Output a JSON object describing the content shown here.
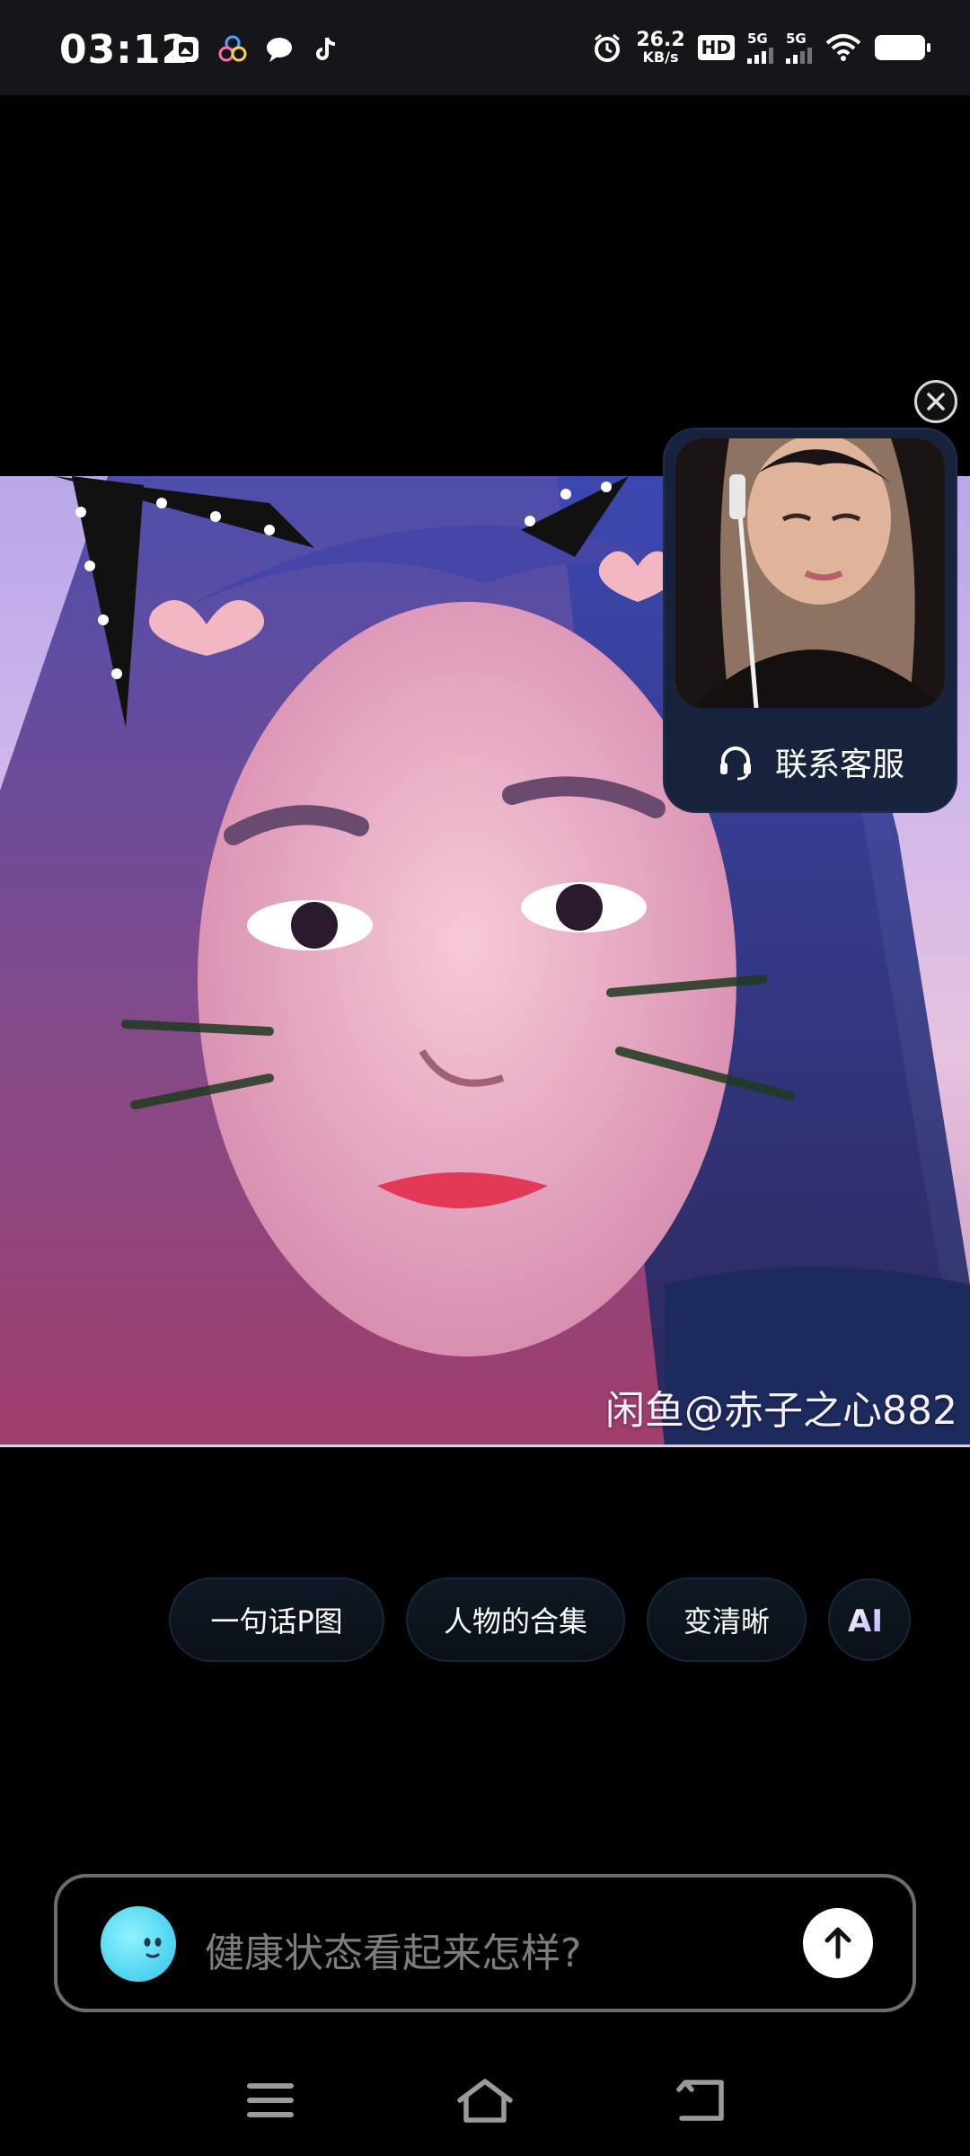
{
  "status_bar": {
    "time": "03:12",
    "net_speed_value": "26.2",
    "net_speed_unit": "KB/s",
    "hd_label": "HD",
    "sim1_label": "5G",
    "sim2_label": "5G",
    "icons": [
      "gallery-app-icon",
      "flower-app-icon",
      "chat-bubble-icon",
      "tiktok-icon",
      "alarm-icon",
      "hd-icon",
      "signal-icon",
      "signal-icon",
      "wifi-icon",
      "battery-icon"
    ]
  },
  "photo": {
    "watermark": "闲鱼@赤子之心882"
  },
  "customer_service": {
    "label": "联系客服"
  },
  "suggestions": [
    {
      "label": "一句话P图"
    },
    {
      "label": "人物的合集"
    },
    {
      "label": "变清晰"
    }
  ],
  "ai_chip": {
    "label": "AI"
  },
  "input": {
    "placeholder": "健康状态看起来怎样?"
  },
  "colors": {
    "background": "#000000",
    "status_bar": "#14161a",
    "card": "#17223d",
    "chip_border": "#18263a",
    "input_border": "#6d6d6d"
  }
}
